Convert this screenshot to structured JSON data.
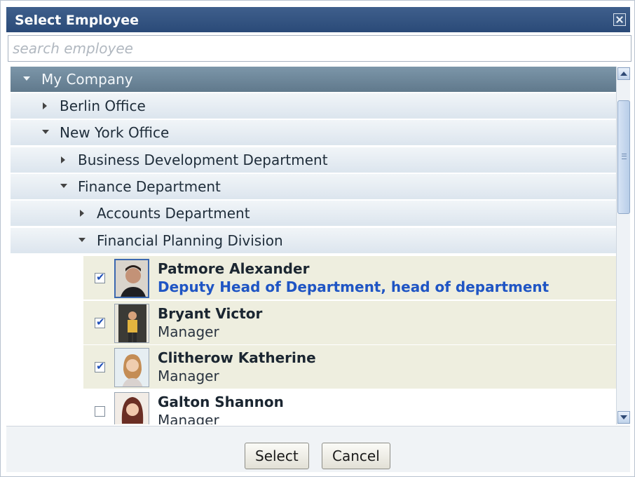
{
  "dialog": {
    "title": "Select Employee",
    "close_icon": "close-icon"
  },
  "search": {
    "placeholder": "search employee",
    "value": ""
  },
  "tree": {
    "root": "My Company",
    "berlin": "Berlin Office",
    "newyork": "New York Office",
    "bizdev": "Business Development Department",
    "finance": "Finance Department",
    "accounts": "Accounts Department",
    "planning": "Financial Planning Division"
  },
  "employees": [
    {
      "name": "Patmore Alexander",
      "role": "Deputy Head of Department, head of department",
      "checked": true
    },
    {
      "name": "Bryant Victor",
      "role": "Manager",
      "checked": true
    },
    {
      "name": "Clitherow Katherine",
      "role": "Manager",
      "checked": true
    },
    {
      "name": "Galton Shannon",
      "role": "Manager",
      "checked": false
    }
  ],
  "buttons": {
    "select": "Select",
    "cancel": "Cancel"
  },
  "colors": {
    "titlebar": "#2f4f7e",
    "selected_row": "#eeeedf",
    "role_highlight": "#1f55c4"
  }
}
